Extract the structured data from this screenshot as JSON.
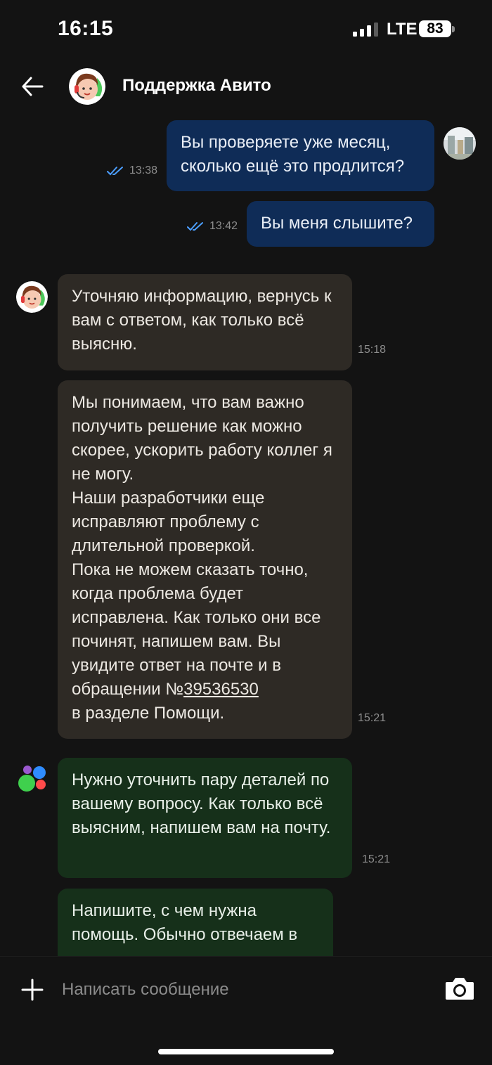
{
  "status_bar": {
    "time": "16:15",
    "network": "LTE",
    "battery": "83"
  },
  "header": {
    "title": "Поддержка Авито"
  },
  "messages": [
    {
      "text": "Вы проверяете уже месяц, сколько ещё это продлится?",
      "time": "13:38",
      "direction": "outgoing"
    },
    {
      "text": "Вы меня слышите?",
      "time": "13:42",
      "direction": "outgoing"
    },
    {
      "text": "Уточняю информацию, вернусь к вам с ответом, как только всё выясню.",
      "time": "15:18",
      "direction": "incoming"
    },
    {
      "text_before_link": "Мы понимаем, что вам важно получить решение как можно скорее, ускорить работу коллег я не могу.\nНаши разработчики еще исправляют проблему с длительной проверкой.\nПока не можем сказать точно, когда проблема будет исправлена. Как только они все починят, напишем вам. Вы увидите ответ на почте и в обращении №",
      "link": "39536530",
      "text_after_link": "\nв разделе Помощи.",
      "time": "15:21",
      "direction": "incoming"
    },
    {
      "text": "Нужно уточнить пару деталей по вашему вопросу. Как только всё выясним, напишем вам на почту.",
      "time": "15:21",
      "direction": "bot"
    },
    {
      "text": "Напишите, с чем нужна помощь. Обычно отвечаем в",
      "direction": "bot"
    }
  ],
  "composer": {
    "placeholder": "Написать сообщение"
  },
  "icons": {
    "back": "arrow-left-icon",
    "add": "plus-icon",
    "camera": "camera-icon",
    "read": "double-check-icon",
    "bot_logo": "avito-dots-logo"
  },
  "colors": {
    "background": "#131313",
    "outgoing_bubble": "#0f2c57",
    "incoming_bubble": "#2e2a25",
    "bot_bubble": "#16301a",
    "read_ticks": "#4c9fff"
  }
}
